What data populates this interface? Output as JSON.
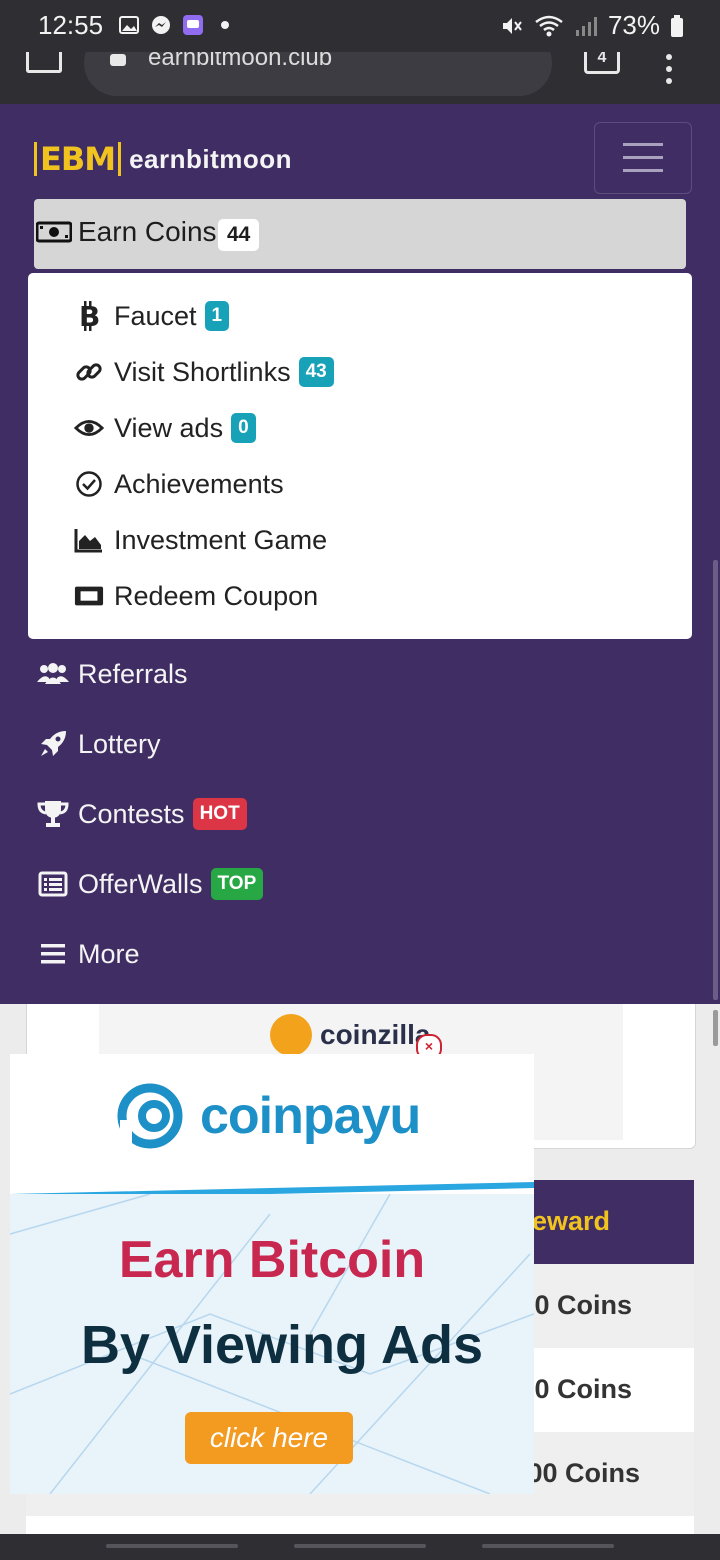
{
  "status_bar": {
    "time": "12:55",
    "battery": "73%"
  },
  "browser": {
    "url": "earnbitmoon.club",
    "tab_count": "4"
  },
  "header": {
    "logo_mark": "EBM",
    "logo_text": "earnbitmoon"
  },
  "earn_coins": {
    "label": "Earn Coins",
    "badge": "44"
  },
  "earn_menu": [
    {
      "label": "Faucet",
      "badge": "1",
      "icon": "bitcoin-icon"
    },
    {
      "label": "Visit Shortlinks",
      "badge": "43",
      "icon": "link-icon"
    },
    {
      "label": "View ads",
      "badge": "0",
      "icon": "eye-icon"
    },
    {
      "label": "Achievements",
      "icon": "check-circle-icon"
    },
    {
      "label": "Investment Game",
      "icon": "area-chart-icon"
    },
    {
      "label": "Redeem Coupon",
      "icon": "ticket-icon"
    }
  ],
  "nav_items": [
    {
      "label": "Referrals",
      "icon": "users-icon"
    },
    {
      "label": "Lottery",
      "icon": "rocket-icon"
    },
    {
      "label": "Contests",
      "badge": "HOT",
      "icon": "trophy-icon"
    },
    {
      "label": "OfferWalls",
      "badge": "TOP",
      "icon": "list-icon"
    },
    {
      "label": "More",
      "icon": "hamburger-icon"
    }
  ],
  "banner": {
    "brand": "coinzilla",
    "close": "×"
  },
  "table": {
    "header_reward": "eward",
    "rows": [
      "00 Coins",
      "00 Coins",
      "00 Coins"
    ]
  },
  "ad": {
    "brand": "coinpayu",
    "line1": "Earn Bitcoin",
    "line2": "By Viewing Ads",
    "cta": "click here"
  },
  "colors": {
    "nav_bg": "#3f2d63",
    "accent_gold": "#f1c31f",
    "badge_info": "#17a2b8",
    "badge_hot": "#dc3545",
    "badge_top": "#28a745"
  }
}
